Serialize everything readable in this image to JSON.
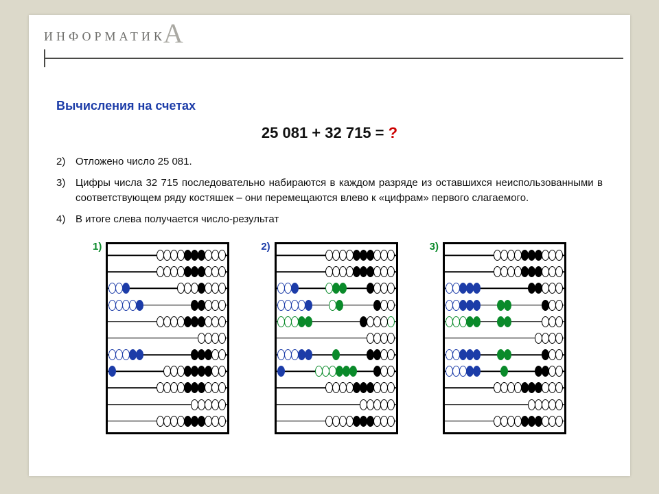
{
  "logo_text": "ИНФОРМАТИК",
  "logo_suffix": "А",
  "title": "Вычисления на счетах",
  "equation_left": "25 081 + 32 715 = ",
  "equation_q": "?",
  "steps": [
    {
      "num": "2)",
      "text": "Отложено число 25 081."
    },
    {
      "num": "3)",
      "text": "Цифры числа 32 715 последовательно набираются в каждом разряде из оставшихся неиспользованными в соответствующем ряду костяшек – они перемещаются влево к «цифрам» первого слагаемого."
    },
    {
      "num": "4)",
      "text": "В итоге слева получается число-результат"
    }
  ],
  "abaci_labels": [
    "1)",
    "2)",
    "3)"
  ],
  "abaci": [
    {
      "rods": [
        {
          "groups": [
            {
              "pos": "right",
              "beads": "oooofffooo",
              "color": "black"
            }
          ]
        },
        {
          "groups": [
            {
              "pos": "right",
              "beads": "oooofffooo",
              "color": "black"
            }
          ]
        },
        {
          "groups": [
            {
              "pos": "left",
              "beads": "oof",
              "color": "blue"
            },
            {
              "pos": "right",
              "beads": "ooofooo",
              "color": "black"
            }
          ]
        },
        {
          "groups": [
            {
              "pos": "left",
              "beads": "oooof",
              "color": "blue"
            },
            {
              "pos": "right",
              "beads": "ffooo",
              "color": "black"
            }
          ]
        },
        {
          "groups": [
            {
              "pos": "right",
              "beads": "oooofffooo",
              "color": "black"
            }
          ]
        },
        {
          "groups": [
            {
              "pos": "right",
              "beads": "oooo",
              "color": "black"
            }
          ]
        },
        {
          "groups": [
            {
              "pos": "left",
              "beads": "oooff",
              "color": "blue"
            },
            {
              "pos": "right",
              "beads": "fffoo",
              "color": "black"
            }
          ]
        },
        {
          "groups": [
            {
              "pos": "left",
              "beads": "f",
              "color": "blue"
            },
            {
              "pos": "right",
              "beads": "oooffffoo",
              "color": "black"
            }
          ]
        },
        {
          "groups": [
            {
              "pos": "right",
              "beads": "oooofffooo",
              "color": "black"
            }
          ]
        },
        {
          "groups": [
            {
              "pos": "right",
              "beads": "ooooo",
              "color": "black"
            }
          ]
        },
        {
          "groups": [
            {
              "pos": "right",
              "beads": "oooofffooo",
              "color": "black"
            }
          ]
        }
      ]
    },
    {
      "rods": [
        {
          "groups": [
            {
              "pos": "right",
              "beads": "oooofffooo",
              "color": "black"
            }
          ]
        },
        {
          "groups": [
            {
              "pos": "right",
              "beads": "oooofffooo",
              "color": "black"
            }
          ]
        },
        {
          "groups": [
            {
              "pos": "left",
              "beads": "oof",
              "color": "blue"
            },
            {
              "pos": "mid",
              "beads": "off",
              "color": "green"
            },
            {
              "pos": "right",
              "beads": "fooo",
              "color": "black"
            }
          ]
        },
        {
          "groups": [
            {
              "pos": "left",
              "beads": "oooof",
              "color": "blue"
            },
            {
              "pos": "mid",
              "beads": "of",
              "color": "green"
            },
            {
              "pos": "right",
              "beads": "foo",
              "color": "black"
            }
          ]
        },
        {
          "groups": [
            {
              "pos": "left",
              "beads": "oooff",
              "color": "green"
            },
            {
              "pos": "right",
              "beads": "o",
              "color": "green"
            },
            {
              "pos": "right",
              "beads": "fooo",
              "color": "black",
              "offset": 12
            }
          ]
        },
        {
          "groups": [
            {
              "pos": "right",
              "beads": "oooo",
              "color": "black"
            }
          ]
        },
        {
          "groups": [
            {
              "pos": "left",
              "beads": "oooff",
              "color": "blue"
            },
            {
              "pos": "mid",
              "beads": "f",
              "color": "green"
            },
            {
              "pos": "right",
              "beads": "ffoo",
              "color": "black"
            }
          ]
        },
        {
          "groups": [
            {
              "pos": "left",
              "beads": "f",
              "color": "blue"
            },
            {
              "pos": "mid",
              "beads": "ooofff",
              "color": "green"
            },
            {
              "pos": "right",
              "beads": "foo",
              "color": "black"
            }
          ]
        },
        {
          "groups": [
            {
              "pos": "right",
              "beads": "oooofffooo",
              "color": "black"
            }
          ]
        },
        {
          "groups": [
            {
              "pos": "right",
              "beads": "ooooo",
              "color": "black"
            }
          ]
        },
        {
          "groups": [
            {
              "pos": "right",
              "beads": "oooofffooo",
              "color": "black"
            }
          ]
        }
      ]
    },
    {
      "rods": [
        {
          "groups": [
            {
              "pos": "right",
              "beads": "oooofffooo",
              "color": "black"
            }
          ]
        },
        {
          "groups": [
            {
              "pos": "right",
              "beads": "oooofffooo",
              "color": "black"
            }
          ]
        },
        {
          "groups": [
            {
              "pos": "left",
              "beads": "oofff",
              "color": "blue"
            },
            {
              "pos": "right",
              "beads": "ffooo",
              "color": "black"
            }
          ]
        },
        {
          "groups": [
            {
              "pos": "left",
              "beads": "oofff",
              "color": "blue"
            },
            {
              "pos": "mid",
              "beads": "ff",
              "color": "green"
            },
            {
              "pos": "right",
              "beads": "foo",
              "color": "black"
            }
          ]
        },
        {
          "groups": [
            {
              "pos": "left",
              "beads": "oooff",
              "color": "green"
            },
            {
              "pos": "mid",
              "beads": "ff",
              "color": "green"
            },
            {
              "pos": "right",
              "beads": "ooo",
              "color": "black"
            }
          ]
        },
        {
          "groups": [
            {
              "pos": "right",
              "beads": "oooo",
              "color": "black"
            }
          ]
        },
        {
          "groups": [
            {
              "pos": "left",
              "beads": "oofff",
              "color": "blue"
            },
            {
              "pos": "mid",
              "beads": "ff",
              "color": "green"
            },
            {
              "pos": "right",
              "beads": "foo",
              "color": "black"
            }
          ]
        },
        {
          "groups": [
            {
              "pos": "left",
              "beads": "oooff",
              "color": "blue"
            },
            {
              "pos": "mid",
              "beads": "f",
              "color": "green"
            },
            {
              "pos": "right",
              "beads": "ffoo",
              "color": "black"
            }
          ]
        },
        {
          "groups": [
            {
              "pos": "right",
              "beads": "oooofffooo",
              "color": "black"
            }
          ]
        },
        {
          "groups": [
            {
              "pos": "right",
              "beads": "ooooo",
              "color": "black"
            }
          ]
        },
        {
          "groups": [
            {
              "pos": "right",
              "beads": "oooofffooo",
              "color": "black"
            }
          ]
        }
      ]
    }
  ]
}
